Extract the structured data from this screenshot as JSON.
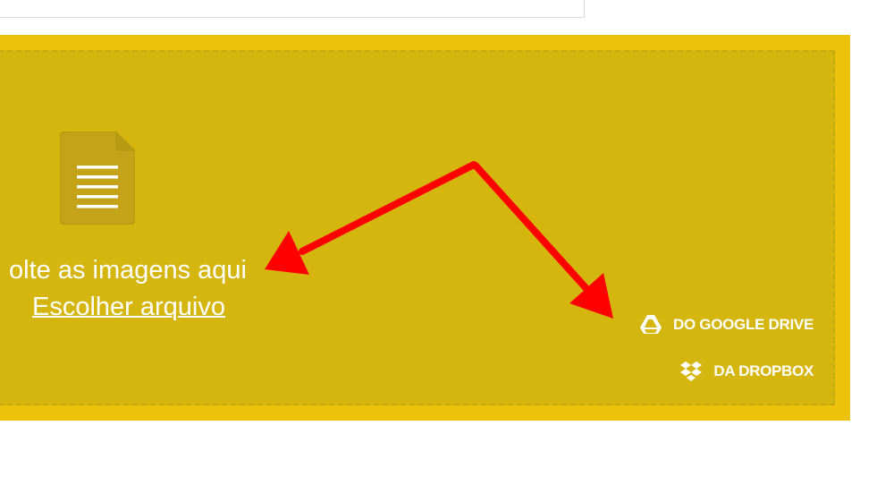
{
  "upload": {
    "drop_text": "olte as imagens aqui",
    "choose_file_label": "Escolher arquivo",
    "google_drive_label": "DO GOOGLE DRIVE",
    "dropbox_label": "DA DROPBOX"
  },
  "icons": {
    "document": "document-icon",
    "google_drive": "google-drive-icon",
    "dropbox": "dropbox-icon"
  },
  "colors": {
    "panel": "#edc20a",
    "drop_zone": "#d5b60f",
    "dashed_border": "#c3a80f",
    "document_icon": "#c4a319",
    "text": "#ffffff",
    "annotation_arrow": "#ff0000"
  }
}
